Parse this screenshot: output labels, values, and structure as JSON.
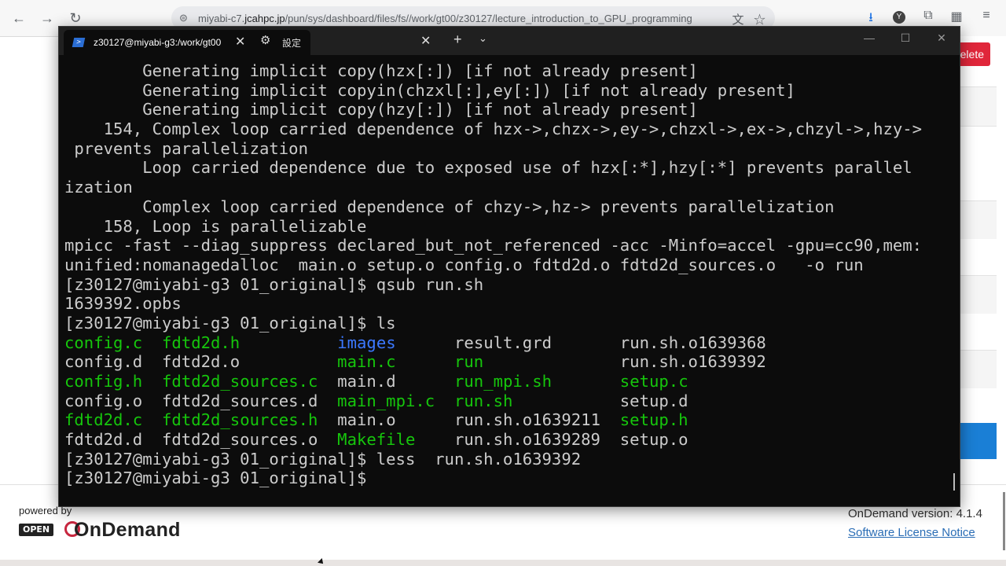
{
  "browser": {
    "back_icon": "arrow-left-icon",
    "forward_icon": "arrow-right-icon",
    "reload_icon": "reload-icon",
    "url_prefix": "miyabi-c7.",
    "url_domain": "jcahpc.jp",
    "url_path": "/pun/sys/dashboard/files/fs//work/gt00/z30127/lecture_introduction_to_GPU_programming"
  },
  "page": {
    "delete_label": "elete",
    "powered_by": "powered by",
    "logo_open": "OPEN",
    "logo_ondemand": "OnDemand",
    "version": "OnDemand version: 4.1.4",
    "license_link": "Software License Notice"
  },
  "terminal": {
    "tab_title": "z30127@miyabi-g3:/work/gt00",
    "settings_tab": "設定",
    "lines": [
      [
        {
          "t": "        Generating implicit copy(hzx[:]) [if not already present]"
        }
      ],
      [
        {
          "t": "        Generating implicit copyin(chzxl[:],ey[:]) [if not already present]"
        }
      ],
      [
        {
          "t": "        Generating implicit copy(hzy[:]) [if not already present]"
        }
      ],
      [
        {
          "t": "    154, Complex loop carried dependence of hzx->,chzx->,ey->,chzxl->,ex->,chzyl->,hzy->"
        }
      ],
      [
        {
          "t": " prevents parallelization"
        }
      ],
      [
        {
          "t": "        Loop carried dependence due to exposed use of hzx[:*],hzy[:*] prevents parallel"
        }
      ],
      [
        {
          "t": "ization"
        }
      ],
      [
        {
          "t": "        Complex loop carried dependence of chzy->,hz-> prevents parallelization"
        }
      ],
      [
        {
          "t": "    158, Loop is parallelizable"
        }
      ],
      [
        {
          "t": "mpicc -fast --diag_suppress declared_but_not_referenced -acc -Minfo=accel -gpu=cc90,mem:"
        }
      ],
      [
        {
          "t": "unified:nomanagedalloc  main.o setup.o config.o fdtd2d.o fdtd2d_sources.o   -o run"
        }
      ],
      [
        {
          "t": "[z30127@miyabi-g3 01_original]$ qsub run.sh"
        }
      ],
      [
        {
          "t": "1639392.opbs"
        }
      ],
      [
        {
          "t": "[z30127@miyabi-g3 01_original]$ ls"
        }
      ],
      [
        {
          "t": "config.c",
          "c": "green"
        },
        {
          "t": "  "
        },
        {
          "t": "fdtd2d.h",
          "c": "green"
        },
        {
          "t": "          "
        },
        {
          "t": "images",
          "c": "blue"
        },
        {
          "t": "      result.grd       run.sh.o1639368"
        }
      ],
      [
        {
          "t": "config.d  fdtd2d.o          "
        },
        {
          "t": "main.c",
          "c": "green"
        },
        {
          "t": "      "
        },
        {
          "t": "run",
          "c": "green"
        },
        {
          "t": "              run.sh.o1639392"
        }
      ],
      [
        {
          "t": "config.h",
          "c": "green"
        },
        {
          "t": "  "
        },
        {
          "t": "fdtd2d_sources.c",
          "c": "green"
        },
        {
          "t": "  main.d      "
        },
        {
          "t": "run_mpi.sh",
          "c": "green"
        },
        {
          "t": "       "
        },
        {
          "t": "setup.c",
          "c": "green"
        }
      ],
      [
        {
          "t": "config.o  fdtd2d_sources.d  "
        },
        {
          "t": "main_mpi.c",
          "c": "green"
        },
        {
          "t": "  "
        },
        {
          "t": "run.sh",
          "c": "green"
        },
        {
          "t": "           setup.d"
        }
      ],
      [
        {
          "t": "fdtd2d.c",
          "c": "green"
        },
        {
          "t": "  "
        },
        {
          "t": "fdtd2d_sources.h",
          "c": "green"
        },
        {
          "t": "  main.o      run.sh.o1639211  "
        },
        {
          "t": "setup.h",
          "c": "green"
        }
      ],
      [
        {
          "t": "fdtd2d.d  fdtd2d_sources.o  "
        },
        {
          "t": "Makefile",
          "c": "green"
        },
        {
          "t": "    run.sh.o1639289  setup.o"
        }
      ],
      [
        {
          "t": "[z30127@miyabi-g3 01_original]$ less  run.sh.o1639392"
        }
      ],
      [
        {
          "t": "[z30127@miyabi-g3 01_original]$ "
        }
      ]
    ]
  }
}
